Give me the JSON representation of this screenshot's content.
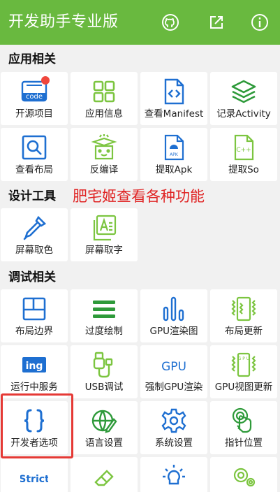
{
  "appbar": {
    "title": "开发助手专业版",
    "actions": [
      {
        "name": "github-icon"
      },
      {
        "name": "share-icon"
      },
      {
        "name": "info-icon"
      }
    ],
    "color": "#69b93f"
  },
  "sections": {
    "app": "应用相关",
    "design": "设计工具",
    "debug": "调试相关"
  },
  "promo_text": "肥宅姬查看各种功能",
  "app_items": [
    {
      "label": "开源项目",
      "icon": "code-icon"
    },
    {
      "label": "应用信息",
      "icon": "grid-icon"
    },
    {
      "label": "查看Manifest",
      "icon": "file-code-icon"
    },
    {
      "label": "记录Activity",
      "icon": "layers-icon"
    },
    {
      "label": "查看布局",
      "icon": "inspect-layout-icon"
    },
    {
      "label": "反编译",
      "icon": "box-icon"
    },
    {
      "label": "提取Apk",
      "icon": "apk-file-icon"
    },
    {
      "label": "提取So",
      "icon": "cpp-file-icon"
    }
  ],
  "design_items": [
    {
      "label": "屏幕取色",
      "icon": "eyedropper-icon"
    },
    {
      "label": "屏幕取字",
      "icon": "text-capture-icon"
    }
  ],
  "debug_items": [
    {
      "label": "布局边界",
      "icon": "layout-bounds-icon"
    },
    {
      "label": "过度绘制",
      "icon": "overdraw-icon"
    },
    {
      "label": "GPU渲染图",
      "icon": "gpu-bars-icon"
    },
    {
      "label": "布局更新",
      "icon": "layout-update-icon"
    },
    {
      "label": "运行中服务",
      "icon": "services-icon"
    },
    {
      "label": "USB调试",
      "icon": "usb-icon"
    },
    {
      "label": "强制GPU渲染",
      "icon": "gpu-text-icon"
    },
    {
      "label": "GPU视图更新",
      "icon": "gpu-view-icon"
    },
    {
      "label": "开发者选项",
      "icon": "braces-icon"
    },
    {
      "label": "语言设置",
      "icon": "globe-icon"
    },
    {
      "label": "系统设置",
      "icon": "gear-icon"
    },
    {
      "label": "指针位置",
      "icon": "pointer-icon"
    },
    {
      "label": "",
      "icon": "strict-icon"
    },
    {
      "label": "",
      "icon": "eraser-icon"
    },
    {
      "label": "",
      "icon": "bulb-icon"
    },
    {
      "label": "",
      "icon": "gears-icon"
    }
  ],
  "icon_text": {
    "code": "code",
    "apk": "APK",
    "cpp": "C++",
    "ing": "ing",
    "gpu": "GPU",
    "gpu_vertical": "G P U",
    "strict": "Strict"
  }
}
